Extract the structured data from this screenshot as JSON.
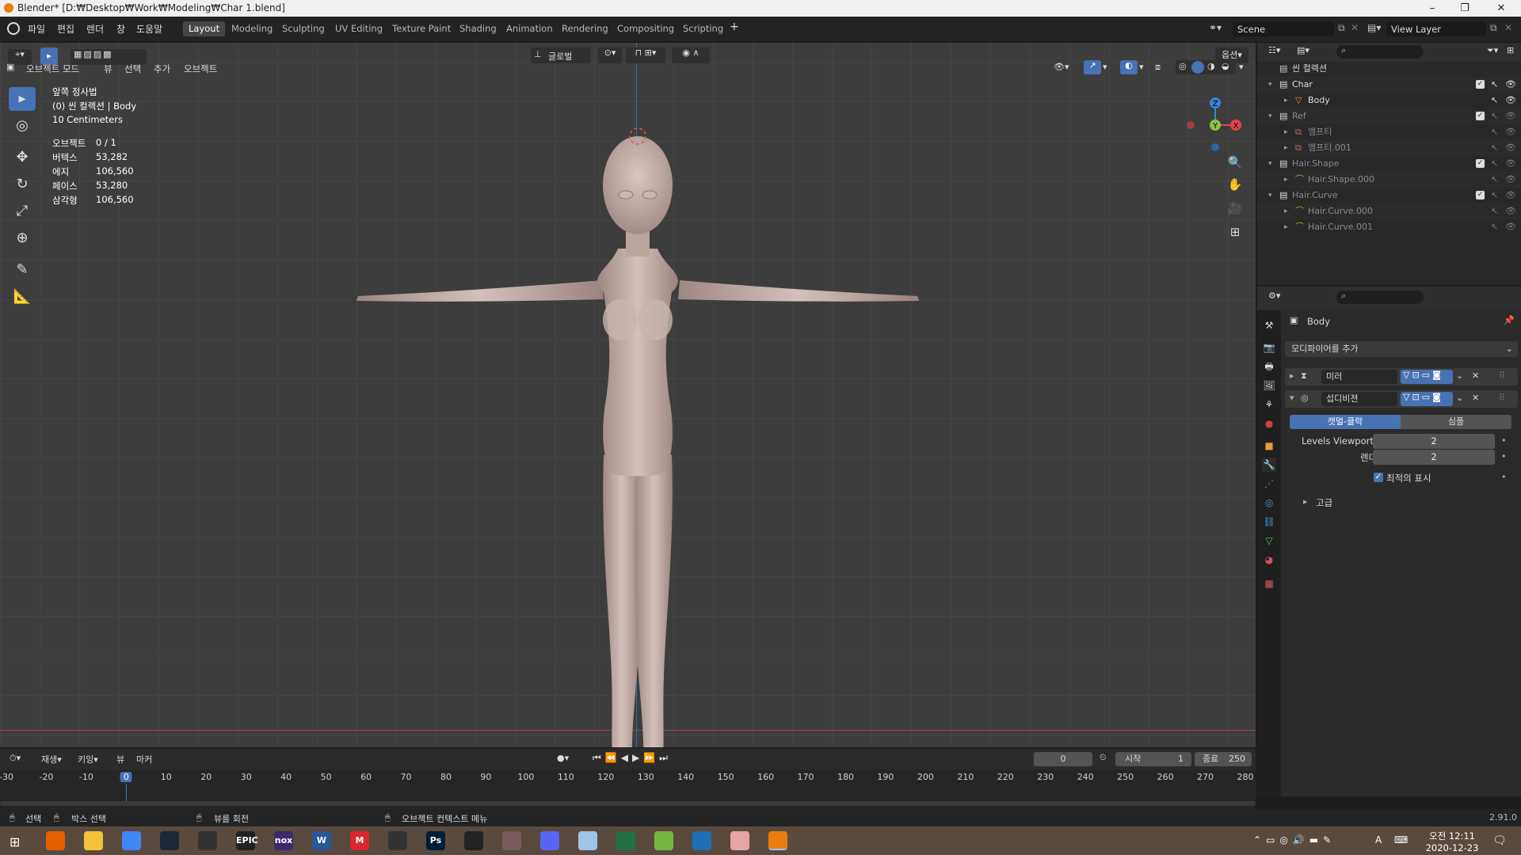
{
  "window": {
    "title": "Blender* [D:₩Desktop₩Work₩Modeling₩Char 1.blend]",
    "minimize": "–",
    "maximize": "❐",
    "close": "✕"
  },
  "menu": [
    "파일",
    "편집",
    "렌더",
    "창",
    "도움말"
  ],
  "workspaces": [
    "Layout",
    "Modeling",
    "Sculpting",
    "UV Editing",
    "Texture Paint",
    "Shading",
    "Animation",
    "Rendering",
    "Compositing",
    "Scripting"
  ],
  "active_workspace": "Layout",
  "scene": {
    "name": "Scene",
    "view_layer": "View Layer"
  },
  "viewport": {
    "mode": "오브젝트 모드",
    "menus": [
      "뷰",
      "선택",
      "추가",
      "오브젝트"
    ],
    "transform_orientation": "글로벌",
    "options_label": "옵션",
    "view_name": "앞쪽 정사법",
    "collection_info": "(0) 씬 컬렉션 | Body",
    "grid_scale": "10 Centimeters",
    "stats": [
      {
        "label": "오브젝트",
        "value": "0 / 1"
      },
      {
        "label": "버텍스",
        "value": "53,282"
      },
      {
        "label": "에지",
        "value": "106,560"
      },
      {
        "label": "페이스",
        "value": "53,280"
      },
      {
        "label": "삼각형",
        "value": "106,560"
      }
    ],
    "gizmo": {
      "z": "Z",
      "y": "Y",
      "x": "X"
    }
  },
  "outliner": {
    "root": "씬 컬렉션",
    "rows": [
      {
        "label": "Char",
        "depth": 1,
        "kind": "collection"
      },
      {
        "label": "Body",
        "depth": 2,
        "kind": "mesh"
      },
      {
        "label": "Ref",
        "depth": 1,
        "kind": "collection",
        "dim": true
      },
      {
        "label": "엠프티",
        "depth": 2,
        "kind": "empty",
        "dim": true
      },
      {
        "label": "엠프티.001",
        "depth": 2,
        "kind": "empty",
        "dim": true
      },
      {
        "label": "Hair.Shape",
        "depth": 1,
        "kind": "collection",
        "dim": true
      },
      {
        "label": "Hair.Shape.000",
        "depth": 2,
        "kind": "curve",
        "dim": true
      },
      {
        "label": "Hair.Curve",
        "depth": 1,
        "kind": "collection",
        "dim": true
      },
      {
        "label": "Hair.Curve.000",
        "depth": 2,
        "kind": "curve",
        "dim": true
      },
      {
        "label": "Hair.Curve.001",
        "depth": 2,
        "kind": "curve",
        "dim": true
      }
    ]
  },
  "properties": {
    "object_name": "Body",
    "add_modifier": "모디파이어를 추가",
    "modifiers": [
      {
        "name": "미러",
        "expanded": false
      },
      {
        "name": "섭디비젼",
        "expanded": true
      }
    ],
    "subdiv_types": [
      "캣멀-클락",
      "심플"
    ],
    "levels_viewport_label": "Levels Viewport",
    "levels_viewport": "2",
    "render_label": "렌더",
    "render_value": "2",
    "optimal_display": "최적의 표시",
    "advanced": "고급"
  },
  "timeline": {
    "menus": [
      "재생",
      "키잉",
      "뷰",
      "마커"
    ],
    "current_frame": "0",
    "start_label": "시작",
    "start": "1",
    "end_label": "종료",
    "end": "250",
    "ticks": [
      "-30",
      "-20",
      "-10",
      "0",
      "10",
      "20",
      "30",
      "40",
      "50",
      "60",
      "70",
      "80",
      "90",
      "100",
      "110",
      "120",
      "130",
      "140",
      "150",
      "160",
      "170",
      "180",
      "190",
      "200",
      "210",
      "220",
      "230",
      "240",
      "250",
      "260",
      "270",
      "280"
    ]
  },
  "statusbar": {
    "select": "선택",
    "box_select": "박스 선택",
    "rotate_view": "뷰를 회전",
    "context_menu": "오브젝트 컨텍스트 메뉴",
    "version": "2.91.0"
  },
  "taskbar": {
    "apps": [
      "firefox",
      "explorer",
      "chrome",
      "steam",
      "uplay",
      "epic",
      "nox",
      "word",
      "mega",
      "toolbox",
      "photoshop",
      "unity",
      "game",
      "discord",
      "paint",
      "excel",
      "utorrent",
      "camera",
      "anime",
      "blender"
    ],
    "labels": {
      "epic": "EPIC",
      "nox": "nox",
      "word": "W",
      "mega": "M",
      "photoshop": "Ps"
    },
    "clock_time": "오전 12:11",
    "clock_date": "2020-12-23",
    "ime": "A"
  },
  "colors": {
    "accent": "#4772b3",
    "active_tab": "#474747",
    "x_axis": "#e5434b",
    "y_axis": "#8bc34a",
    "z_axis": "#3d82d6",
    "playhead": "#4772b3"
  }
}
